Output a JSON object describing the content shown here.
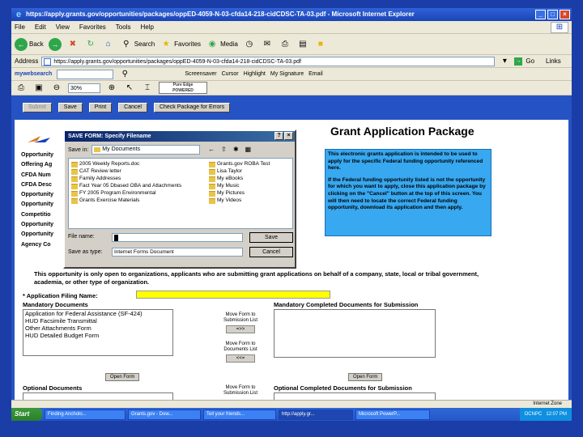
{
  "window": {
    "title": "https://apply.grants.gov/opportunities/packages/oppED-4059-N-03-cfda14-218-cidCDSC-TA-03.pdf - Microsoft Internet Explorer",
    "buttons": [
      "_",
      "□",
      "×"
    ]
  },
  "menu": [
    "File",
    "Edit",
    "View",
    "Favorites",
    "Tools",
    "Help"
  ],
  "toolbar": {
    "back": "Back",
    "search": "Search",
    "favorites": "Favorites",
    "media": "Media"
  },
  "address": {
    "label": "Address",
    "value": "https://apply.grants.gov/opportunities/packages/oppED-4059-N-03-cfda14-218-cidCDSC-TA-03.pdf",
    "go": "Go",
    "links": "Links"
  },
  "searchbar": {
    "brand": "mywebsearch",
    "items": [
      "Screensaver",
      "Cursor",
      "Highlight",
      "My Signature",
      "Email"
    ]
  },
  "formbar": {
    "zoom": "30%",
    "logo_line1": "Pure Edge",
    "logo_line2": "POWERED"
  },
  "actions": [
    "Submit",
    "Save",
    "Print",
    "Cancel",
    "Check Package for Errors"
  ],
  "grant": {
    "title": "Grant Application Package",
    "left_labels": [
      "Opportunity",
      "Offering Ag",
      "CFDA Num",
      "CFDA Desc",
      "Opportunity",
      "Opportunity",
      "Competitio",
      "Opportunity",
      "Opportunity",
      "Agency Co"
    ],
    "info_para1": "This electronic grants application is intended to be used to apply for the specific Federal funding opportunity referenced here.",
    "info_para2": "If the Federal funding opportunity listed is not the opportunity for which you want to apply, close this application package by clicking on the \"Cancel\" button at the top of this screen. You will then need to locate the correct Federal funding opportunity, download its application and then apply.",
    "notice": "This opportunity is only open to organizations, applicants who are submitting grant applications on behalf of a company, state, local or tribal government, academia, or other type of organization.",
    "filing_label": "* Application Filing Name:",
    "mandatory_title": "Mandatory Documents",
    "mandatory_items": [
      "Application for Federal Assistance (SF-424)",
      "HUD Facsimile Transmittal",
      "Other Attachments Form",
      "HUD Detailed Budget Form"
    ],
    "move_to_submission": "Move Form to Submission List",
    "move_to_documents": "Move Form to Documents List",
    "move_right": "=>>",
    "move_left": "<<=",
    "completed_title": "Mandatory Completed Documents for Submission",
    "open_form": "Open Form",
    "optional_title": "Optional Documents",
    "optional_completed_title": "Optional Completed Documents for Submission"
  },
  "dialog": {
    "title": "SAVE FORM: Specify Filename",
    "save_in_label": "Save in:",
    "save_in_value": "My Documents",
    "files_col1": [
      "2005 Weekly Reports.doc",
      "CAT Review letter",
      "Family Addresses",
      "Fact Year 05 Dbased OBA and Attachments",
      "FY 2005 Program Environmental",
      "Grants Exercise Materials"
    ],
    "files_col2": [
      "Grants.gov ROBA Test",
      "Lisa Taylor",
      "My eBooks",
      "My Music",
      "My Pictures",
      "My Videos"
    ],
    "file_name_label": "File name:",
    "save_type_label": "Save as type:",
    "save_type_value": "Internet Forms Document",
    "save_button": "Save",
    "cancel_button": "Cancel"
  },
  "status": {
    "zone": "Internet Zone"
  },
  "taskbar": {
    "start": "Start",
    "tasks": [
      "Finding Ancholo...",
      "Grants.gov - Dow...",
      "Tell your friends...",
      "http://apply.gr...",
      "Microsoft PowerP..."
    ],
    "tray": [
      "OCNPC",
      "12:07 PM"
    ]
  }
}
